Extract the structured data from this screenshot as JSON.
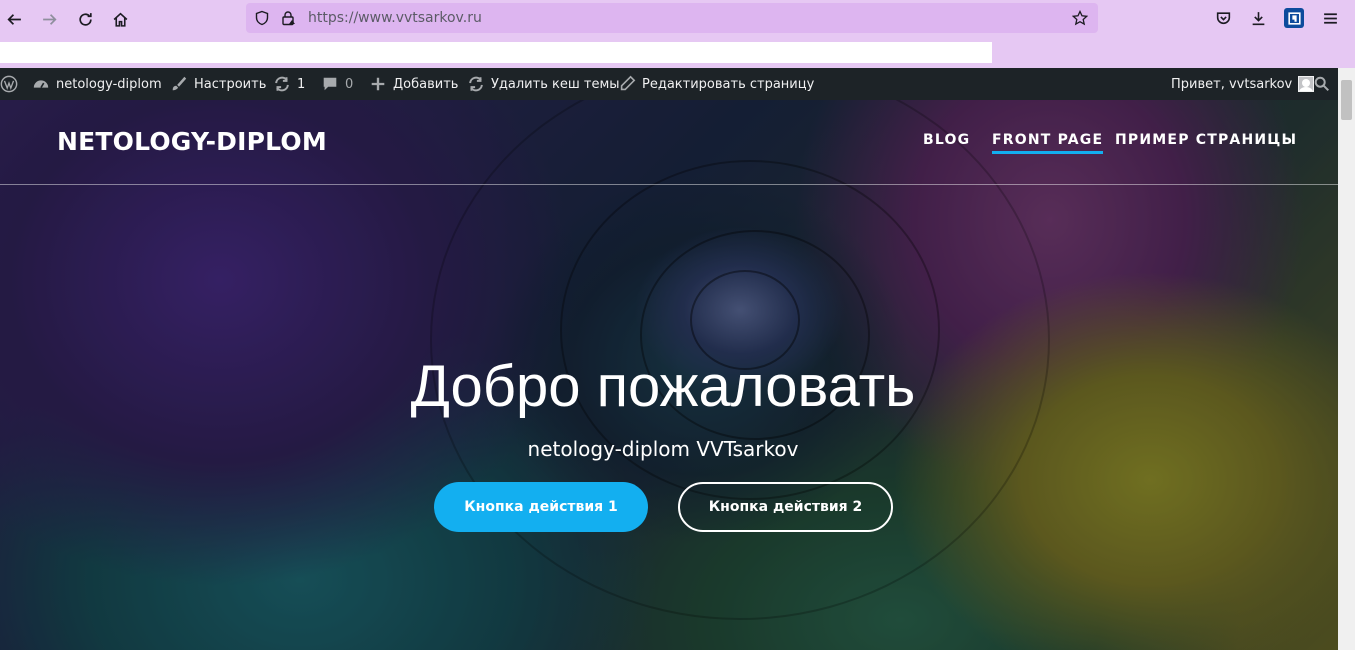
{
  "browser": {
    "url": "https://www.vvtsarkov.ru",
    "icons": [
      "back-icon",
      "forward-icon",
      "reload-icon",
      "home-icon",
      "shield-icon",
      "lock-icon",
      "star-icon",
      "pocket-icon",
      "download-icon",
      "extension-icon",
      "menu-icon"
    ]
  },
  "admin_bar": {
    "site_name": "netology-diplom",
    "customize": "Настроить",
    "updates_count": "1",
    "comments_count": "0",
    "add_new": "Добавить",
    "clear_cache": "Удалить кеш темы",
    "edit_page": "Редактировать страницу",
    "greeting": "Привет, vvtsarkov"
  },
  "site": {
    "title": "NETOLOGY-DIPLOM",
    "menu": [
      {
        "label": "BLOG",
        "active": false
      },
      {
        "label": "FRONT PAGE",
        "active": true
      },
      {
        "label": "ПРИМЕР СТРАНИЦЫ",
        "active": false
      }
    ]
  },
  "hero": {
    "title": "Добро пожаловать",
    "subtitle": "netology-diplom VVTsarkov",
    "button_primary": "Кнопка действия 1",
    "button_secondary": "Кнопка действия 2"
  },
  "colors": {
    "accent": "#13aff0",
    "admin_bar": "#1d2327",
    "browser_chrome": "#e6c8f3"
  }
}
